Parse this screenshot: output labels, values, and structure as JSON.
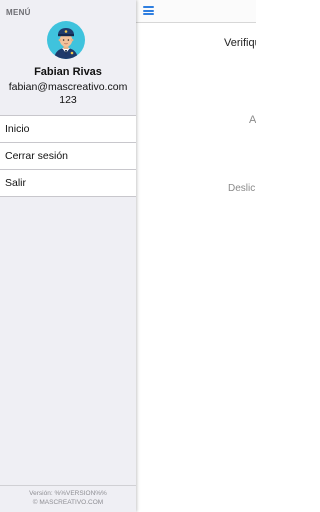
{
  "main": {
    "title": "Verifiqu",
    "text_a": "A",
    "text_deslic": "Deslic"
  },
  "drawer": {
    "header": "MENÚ",
    "user": {
      "avatar_icon": "police-officer-avatar-icon",
      "name": "Fabian Rivas",
      "email": "fabian@mascreativo.com",
      "code": "123"
    },
    "items": [
      {
        "label": "Inicio"
      },
      {
        "label": "Cerrar sesión"
      },
      {
        "label": "Salir"
      }
    ],
    "footer": {
      "version": "Versión: %%VERSION%%",
      "copyright": "© MASCREATIVO.COM"
    }
  },
  "colors": {
    "drawer_bg": "#efeff4",
    "accent": "#2f7fe0",
    "avatar_bg": "#3fc3dd"
  }
}
